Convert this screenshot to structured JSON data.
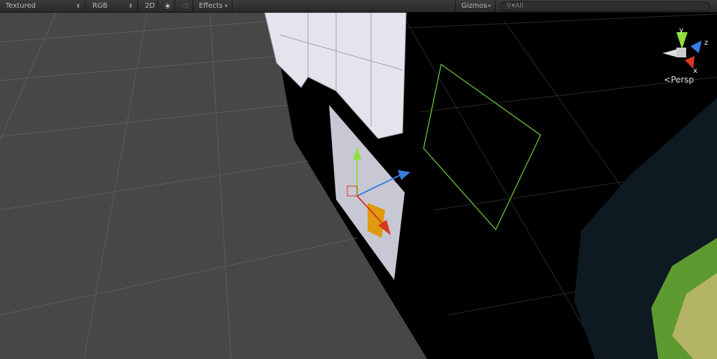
{
  "toolbar": {
    "draw_mode": "Textured",
    "render_mode": "RGB",
    "toggle_2d": "2D",
    "lighting_icon": "sun-icon",
    "audio_icon": "speaker-icon",
    "effects": "Effects",
    "gizmos": "Gizmos",
    "search_placeholder": "All"
  },
  "gizmo": {
    "y": "y",
    "z": "z",
    "x": "x",
    "projection": "Persp"
  },
  "colors": {
    "floor": "#474747",
    "grid": "#5a5a5a",
    "wire": "#6fd23a",
    "axis_y": "#8fe03a",
    "axis_z": "#3a7de0",
    "axis_x": "#d8381e"
  }
}
